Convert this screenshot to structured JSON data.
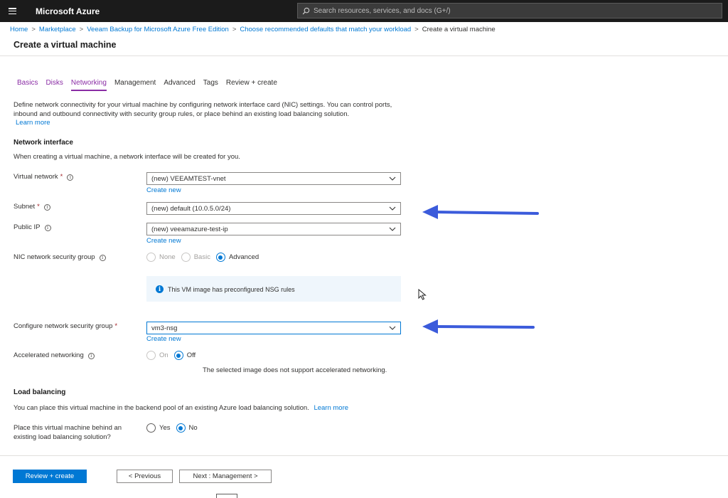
{
  "header": {
    "brand": "Microsoft Azure",
    "search_placeholder": "Search resources, services, and docs (G+/)"
  },
  "breadcrumb": {
    "items": [
      "Home",
      "Marketplace",
      "Veeam Backup for Microsoft Azure Free Edition",
      "Choose recommended defaults that match your workload"
    ],
    "current": "Create a virtual machine",
    "separator": ">"
  },
  "page": {
    "title": "Create a virtual machine"
  },
  "tabs": [
    {
      "label": "Basics",
      "state": "visited"
    },
    {
      "label": "Disks",
      "state": "visited"
    },
    {
      "label": "Networking",
      "state": "active"
    },
    {
      "label": "Management",
      "state": "default"
    },
    {
      "label": "Advanced",
      "state": "default"
    },
    {
      "label": "Tags",
      "state": "default"
    },
    {
      "label": "Review + create",
      "state": "default"
    }
  ],
  "intro": {
    "text": "Define network connectivity for your virtual machine by configuring network interface card (NIC) settings. You can control ports, inbound and outbound connectivity with security group rules, or place behind an existing load balancing solution.",
    "learn_more": "Learn more"
  },
  "network_interface": {
    "heading": "Network interface",
    "subtext": "When creating a virtual machine, a network interface will be created for you.",
    "virtual_network": {
      "label": "Virtual network",
      "value": "(new) VEEAMTEST-vnet",
      "create_new": "Create new"
    },
    "subnet": {
      "label": "Subnet",
      "value": "(new) default (10.0.5.0/24)"
    },
    "public_ip": {
      "label": "Public IP",
      "value": "(new) veeamazure-test-ip",
      "create_new": "Create new"
    },
    "nic_nsg": {
      "label": "NIC network security group",
      "options": [
        "None",
        "Basic",
        "Advanced"
      ],
      "selected": "Advanced"
    },
    "info_box": "This VM image has preconfigured NSG rules",
    "configure_nsg": {
      "label": "Configure network security group",
      "value": "vm3-nsg",
      "create_new": "Create new"
    },
    "accelerated": {
      "label": "Accelerated networking",
      "options": [
        "On",
        "Off"
      ],
      "selected": "Off",
      "note": "The selected image does not support accelerated networking."
    }
  },
  "load_balancing": {
    "heading": "Load balancing",
    "subtext": "You can place this virtual machine in the backend pool of an existing Azure load balancing solution.",
    "learn_more": "Learn more",
    "question_line1": "Place this virtual machine behind an",
    "question_line2": "existing load balancing solution?",
    "options": [
      "Yes",
      "No"
    ],
    "selected": "No"
  },
  "footer": {
    "review_create": "Review + create",
    "previous": "< Previous",
    "next": "Next : Management >"
  },
  "colors": {
    "accent": "#0078d4",
    "visited_tab": "#8a2da5",
    "annotation_arrow": "#3b5bdb",
    "topbar": "#1b1b1b"
  }
}
